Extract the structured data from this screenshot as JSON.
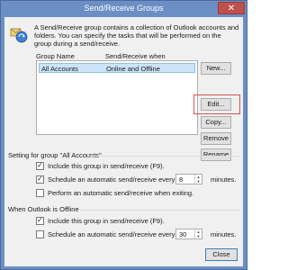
{
  "window": {
    "title": "Send/Receive Groups",
    "close_glyph": "✕"
  },
  "description": "A Send/Receive group contains a collection of Outlook accounts and folders. You can specify the tasks that will be performed on the group during a send/receive.",
  "groups_table": {
    "headers": [
      "Group Name",
      "Send/Receive when"
    ],
    "rows": [
      {
        "name": "All Accounts",
        "when": "Online and Offline",
        "selected": true
      }
    ]
  },
  "buttons": {
    "new": "New...",
    "edit": "Edit...",
    "copy": "Copy...",
    "remove": "Remove",
    "rename": "Rename",
    "close": "Close"
  },
  "settings_group": {
    "header": "Setting for group \"All Accounts\"",
    "include": {
      "label": "Include this group in send/receive (F9).",
      "checked": true
    },
    "schedule": {
      "label": "Schedule an automatic send/receive every",
      "checked": true,
      "value": "8",
      "unit": "minutes."
    },
    "on_exit": {
      "label": "Perform an automatic send/receive when exiting.",
      "checked": false
    }
  },
  "offline_group": {
    "header": "When Outlook is Offline",
    "include": {
      "label": "Include this group in send/receive (F9).",
      "checked": true
    },
    "schedule": {
      "label": "Schedule an automatic send/receive every",
      "checked": false,
      "value": "30",
      "unit": "minutes."
    }
  },
  "colors": {
    "titlebar": "#6b8fc4",
    "selection": "#cce4f7",
    "highlight_box": "#d9534f"
  },
  "icons": {
    "app": "send-receive-icon",
    "close": "close-icon"
  }
}
